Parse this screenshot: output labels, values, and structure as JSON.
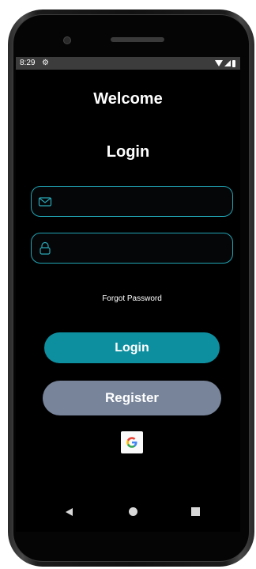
{
  "status_bar": {
    "time": "8:29",
    "settings_icon": "gear-icon",
    "wifi_icon": "wifi-icon",
    "signal_icon": "signal-icon",
    "battery_icon": "battery-icon"
  },
  "header": {
    "welcome": "Welcome",
    "login_title": "Login"
  },
  "form": {
    "email_icon": "envelope-icon",
    "email_value": "",
    "password_icon": "lock-icon",
    "password_value": "",
    "forgot_password": "Forgot Password"
  },
  "buttons": {
    "login": "Login",
    "register": "Register",
    "google_icon": "google-icon"
  },
  "nav_bar": {
    "back_icon": "back-triangle-icon",
    "home_icon": "home-circle-icon",
    "recents_icon": "recents-square-icon"
  },
  "colors": {
    "field_border": "#21a4b4",
    "login_button": "#0e8fa0",
    "register_button": "#77849a",
    "background": "#000000"
  }
}
